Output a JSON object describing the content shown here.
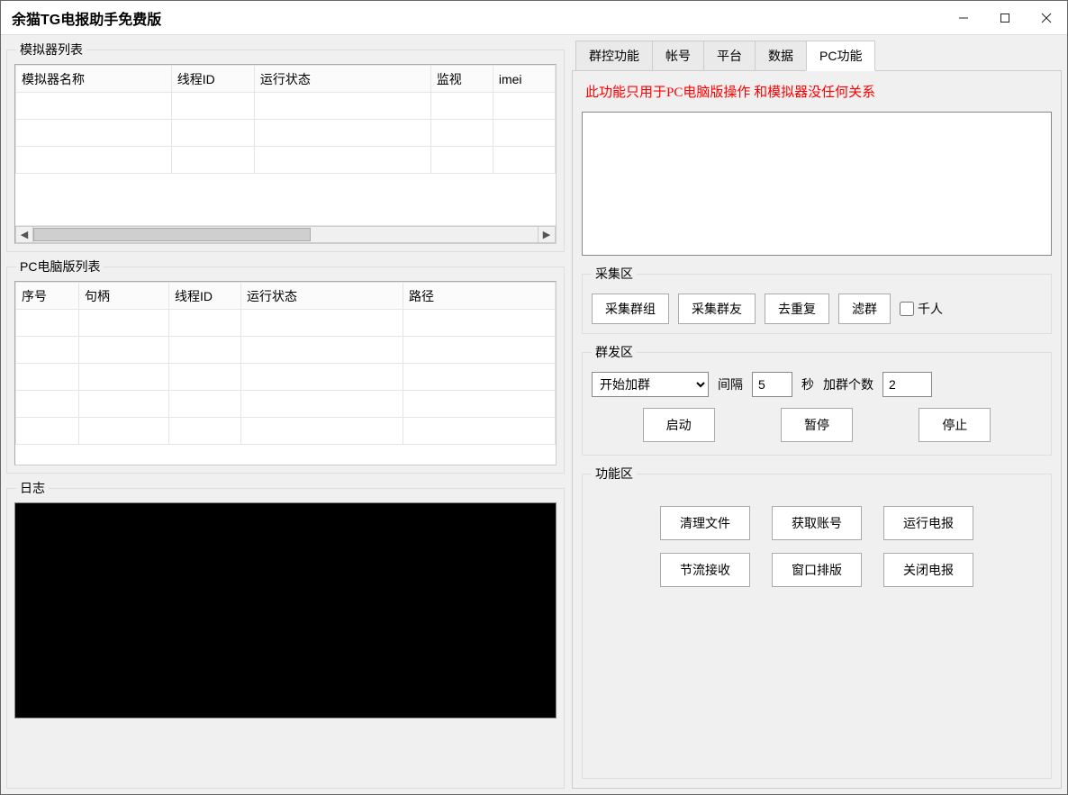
{
  "window": {
    "title": "余猫TG电报助手免费版"
  },
  "left": {
    "emulator": {
      "legend": "模拟器列表",
      "columns": [
        "模拟器名称",
        "线程ID",
        "运行状态",
        "监视",
        "imei"
      ]
    },
    "pclist": {
      "legend": "PC电脑版列表",
      "columns": [
        "序号",
        "句柄",
        "线程ID",
        "运行状态",
        "路径"
      ]
    },
    "log": {
      "legend": "日志"
    }
  },
  "tabs": {
    "items": [
      "群控功能",
      "帐号",
      "平台",
      "数据",
      "PC功能"
    ],
    "active_index": 4
  },
  "pc_panel": {
    "notice": "此功能只用于PC电脑版操作 和模拟器没任何关系",
    "collect": {
      "legend": "采集区",
      "btn_group": "采集群组",
      "btn_friends": "采集群友",
      "btn_dedup": "去重复",
      "btn_filter": "滤群",
      "chk_thousand": "千人"
    },
    "send": {
      "legend": "群发区",
      "action_select": "开始加群",
      "interval_label": "间隔",
      "interval_value": "5",
      "interval_unit": "秒",
      "count_label": "加群个数",
      "count_value": "2",
      "start": "启动",
      "pause": "暂停",
      "stop": "停止"
    },
    "func": {
      "legend": "功能区",
      "btn_clean": "清理文件",
      "btn_getacct": "获取账号",
      "btn_run": "运行电报",
      "btn_throttle": "节流接收",
      "btn_layout": "窗口排版",
      "btn_close": "关闭电报"
    }
  }
}
